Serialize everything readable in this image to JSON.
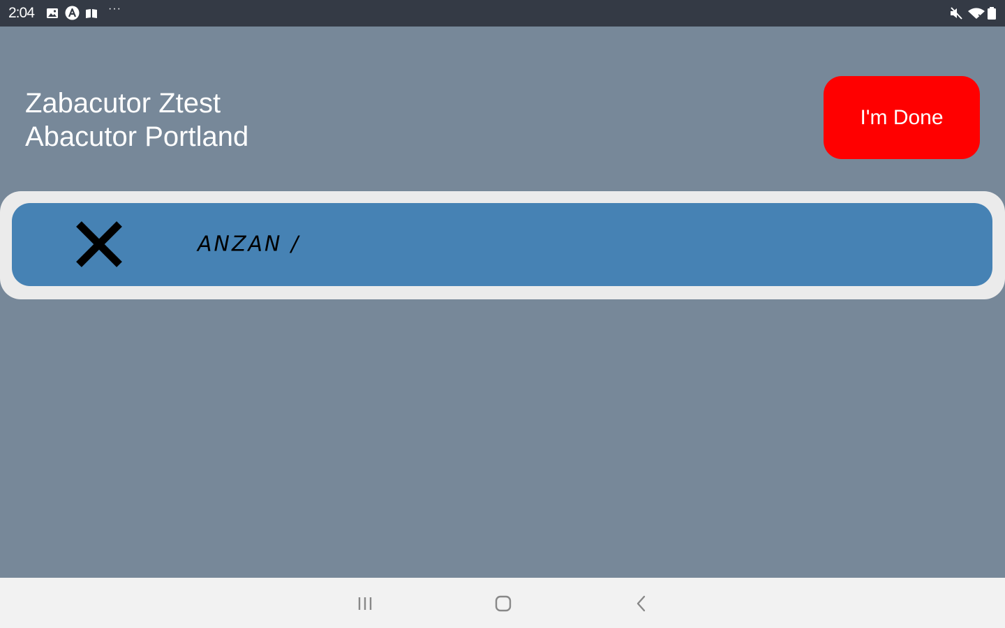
{
  "status_bar": {
    "time": "2:04",
    "left_icons": [
      "gallery-icon",
      "a-circle-icon",
      "book-icon",
      "more-dots-icon"
    ],
    "more_text": "···",
    "right_icons": [
      "mute-icon",
      "wifi-icon",
      "battery-icon"
    ]
  },
  "header": {
    "title_line1": "Zabacutor Ztest",
    "title_line2": "Abacutor Portland",
    "done_label": "I'm Done"
  },
  "list": {
    "items": [
      {
        "label": "ANZAN /",
        "status_icon": "x-mark-icon"
      }
    ]
  },
  "nav_bar": {
    "buttons": [
      "recents-icon",
      "home-icon",
      "back-icon"
    ]
  },
  "colors": {
    "background": "#778899",
    "status_bar": "#343a45",
    "done_button": "#ff0000",
    "row_frame": "#ebebeb",
    "row_card": "#4682b4",
    "nav_bar": "#f2f2f2"
  }
}
